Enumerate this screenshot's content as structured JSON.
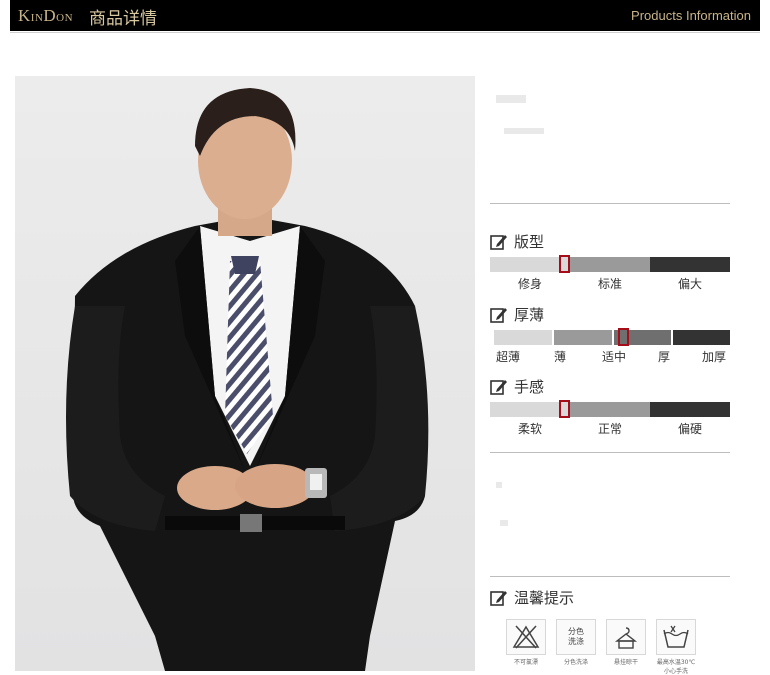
{
  "header": {
    "brand_k": "K",
    "brand_in": "IN",
    "brand_d": "D",
    "brand_on": "ON",
    "title": "商品详情",
    "title_en": "Products Information"
  },
  "photo": {
    "icon": "product-photo-man-in-black-suit"
  },
  "attributes": [
    {
      "title": "版型",
      "labels": [
        "修身",
        "标准",
        "偏大"
      ],
      "selected": "修身"
    },
    {
      "title": "厚薄",
      "labels": [
        "超薄",
        "薄",
        "适中",
        "厚",
        "加厚"
      ],
      "selected": "适中"
    },
    {
      "title": "手感",
      "labels": [
        "柔软",
        "正常",
        "偏硬"
      ],
      "selected": "柔软"
    }
  ],
  "tips": {
    "title": "温馨提示",
    "icons": [
      {
        "icon": "no-bleach-icon",
        "caption": "不可氯漂"
      },
      {
        "icon": "separate-wash-icon",
        "box_line1": "分色",
        "box_line2": "洗涤",
        "caption": "分色洗涤"
      },
      {
        "icon": "hang-dry-icon",
        "caption": "悬挂晾干"
      },
      {
        "icon": "wash-30c-icon",
        "caption": "最高水温30℃",
        "caption2": "小心手洗"
      }
    ]
  },
  "colors": {
    "header_bg": "#000000",
    "header_text": "#c8b48a",
    "bar_light": "#d9d9d9",
    "bar_mid": "#9a9a9a",
    "bar_dark": "#333333",
    "marker": "#a50d1b"
  }
}
